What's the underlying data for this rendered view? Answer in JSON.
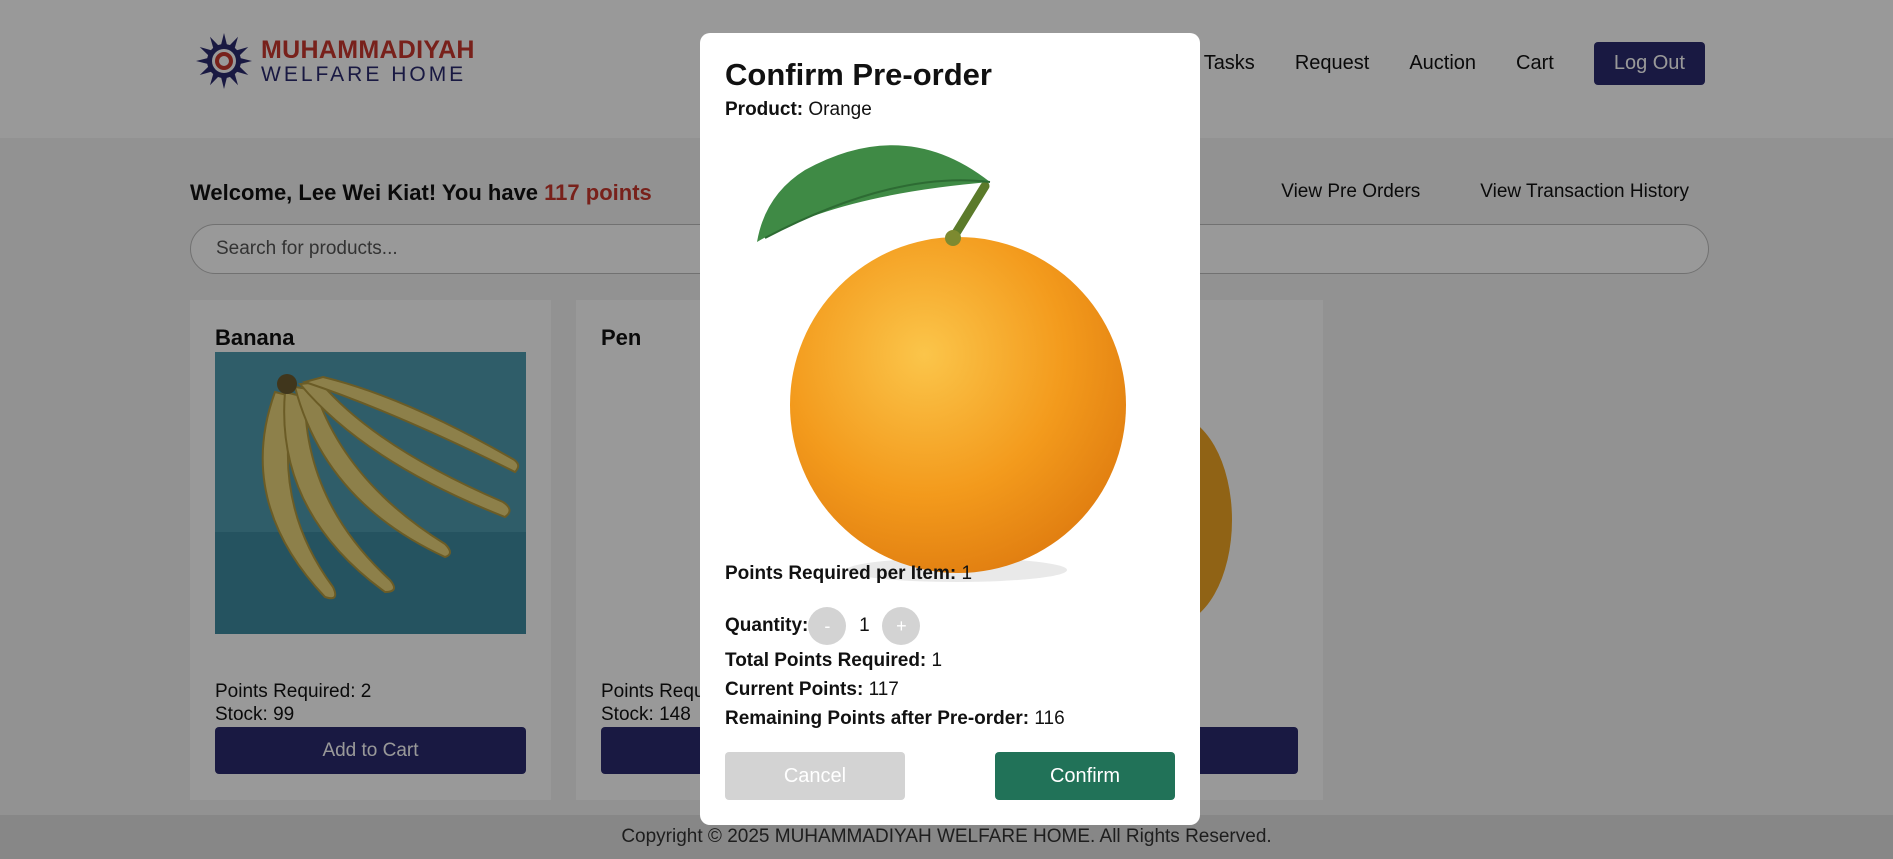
{
  "header": {
    "logo_line1": "MUHAMMADIYAH",
    "logo_line2": "WELFARE HOME",
    "nav": [
      "Tasks",
      "Request",
      "Auction",
      "Cart"
    ],
    "logout_label": "Log Out"
  },
  "welcome": {
    "prefix": "Welcome, Lee Wei Kiat! You have ",
    "points": "117 points"
  },
  "sub_links": [
    "View Pre Orders",
    "View Transaction History"
  ],
  "search": {
    "placeholder": "Search for products..."
  },
  "products": [
    {
      "name": "Banana",
      "points": "Points Required: 2",
      "stock": "Stock: 99",
      "button": "Add to Cart"
    },
    {
      "name": "Pen",
      "points": "Points Required: 1",
      "stock": "Stock: 148",
      "button": "Add to Cart"
    },
    {
      "name": "",
      "points": "",
      "stock": "",
      "button": ""
    }
  ],
  "footer": "Copyright © 2025 MUHAMMADIYAH WELFARE HOME. All Rights Reserved.",
  "modal": {
    "title": "Confirm Pre-order",
    "product_label": "Product:",
    "product_value": "Orange",
    "points_per_item_label": "Points Required per Item:",
    "points_per_item_value": "1",
    "quantity_label": "Quantity:",
    "quantity_minus": "-",
    "quantity_value": "1",
    "quantity_plus": "+",
    "total_label": "Total Points Required:",
    "total_value": "1",
    "current_label": "Current Points:",
    "current_value": "117",
    "remaining_label": "Remaining Points after Pre-order:",
    "remaining_value": "116",
    "cancel_label": "Cancel",
    "confirm_label": "Confirm"
  },
  "colors": {
    "brand_navy": "#2b2a6f",
    "brand_red": "#c8372d",
    "confirm_green": "#217258",
    "disabled_gray": "#d3d3d3"
  }
}
